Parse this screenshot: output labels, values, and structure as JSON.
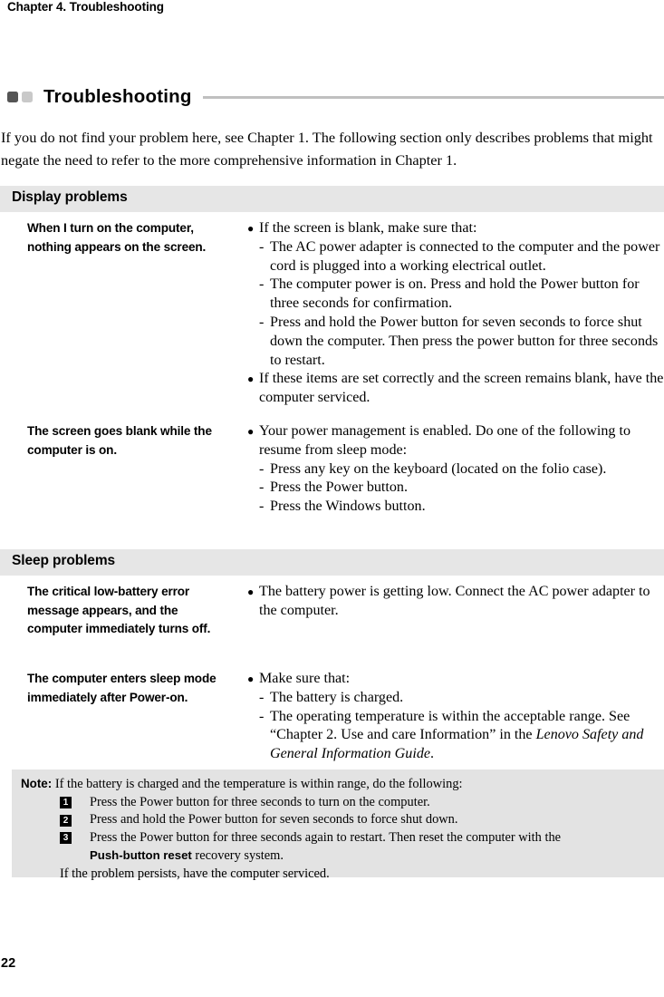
{
  "page": {
    "running_head": "Chapter 4. Troubleshooting",
    "folio": "22"
  },
  "section": {
    "title": "Troubleshooting",
    "marker_dark_color": "#555555",
    "marker_light_color": "#c9c9c9",
    "rule_color": "#c0c0c0"
  },
  "intro": "If you do not find your problem here, see Chapter 1. The following section only describes problems that might negate the need to refer to the more comprehensive information in Chapter 1.",
  "categories": [
    {
      "label": "Display problems",
      "bar_color": "#e6e6e6",
      "rows": [
        {
          "question": "When I turn on the computer, nothing appears on the screen.",
          "bullets": [
            {
              "text": "If the screen is blank, make sure that:",
              "subitems": [
                "The AC power adapter is connected to the computer and the power cord is plugged into a working electrical outlet.",
                "The computer power is on. Press and hold the Power button for three seconds for confirmation.",
                "Press and hold the Power button for seven seconds to force shut down the computer. Then press the power button for three seconds to restart."
              ]
            },
            {
              "text": "If these items are set correctly and the screen remains blank, have the computer serviced.",
              "subitems": []
            }
          ]
        },
        {
          "question": "The screen goes blank while the computer is on.",
          "bullets": [
            {
              "text": "Your power management is enabled. Do one of the following to resume from sleep mode:",
              "subitems": [
                "Press any key on the keyboard (located on the folio case).",
                "Press the Power button.",
                "Press the Windows button."
              ]
            }
          ]
        }
      ]
    },
    {
      "label": "Sleep problems",
      "bar_color": "#e6e6e6",
      "rows": [
        {
          "question": "The critical low-battery error message appears, and the computer immediately turns off.",
          "bullets": [
            {
              "text": "The battery power is getting low. Connect the AC power adapter to the computer.",
              "subitems": []
            }
          ]
        },
        {
          "question": "The computer enters sleep mode immediately after Power-on.",
          "bullets": [
            {
              "text": "Make sure that:",
              "subitems": []
            }
          ]
        }
      ]
    }
  ],
  "sleep_row2_subitems": {
    "item1": "The battery is charged.",
    "item2_pre": "The operating temperature is within the acceptable range. See “Chapter 2. Use and care Information” in the ",
    "item2_italic": "Lenovo Safety and General Information Guide",
    "item2_post": "."
  },
  "note": {
    "background": "#e3e3e3",
    "label": "Note:",
    "intro": " If the battery is charged and the temperature is within range, do the following:",
    "steps": [
      {
        "num": "1",
        "text": "Press the Power button for three seconds to turn on the computer."
      },
      {
        "num": "2",
        "text": "Press and hold the Power button for seven seconds to force shut down."
      },
      {
        "num": "3",
        "text": "Press the Power button for three seconds again to restart. Then reset the computer with the "
      }
    ],
    "step3_bold": "Push-button reset",
    "step3_tail": " recovery system.",
    "tail": "If the problem persists, have the computer serviced."
  }
}
